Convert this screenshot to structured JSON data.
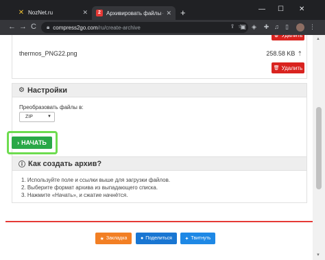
{
  "browser": {
    "tabs": [
      {
        "title": "NozNet.ru",
        "close": "✕"
      },
      {
        "title": "Архивировать файлы — Сжима",
        "close": "✕"
      }
    ],
    "new_tab": "+",
    "window_controls": {
      "minimize": "—",
      "maximize": "☐",
      "close": "✕"
    },
    "nav": {
      "back": "←",
      "forward": "→",
      "reload": "C"
    },
    "address": {
      "host": "compress2go.com",
      "path": "/ru/create-archive"
    }
  },
  "file": {
    "name": "thermos_PNG22.png",
    "size": "258.58 KB",
    "delete_label": "Удалить"
  },
  "settings": {
    "title": "Настройки",
    "convert_label": "Преобразовать файлы в:",
    "format": "ZIP"
  },
  "start_label": "НАЧАТЬ",
  "howto": {
    "title": "Как создать архив?",
    "steps": [
      "1. Используйте поле и ссылки выше для загрузки файлов.",
      "2. Выберите формат архива из выпадающего списка.",
      "3. Нажмите «Начать», и сжатие начнётся."
    ]
  },
  "share": {
    "bookmark": "Закладка",
    "facebook": "Поделиться",
    "twitter": "Твитнуть"
  },
  "colors": {
    "delete": "#d9231f",
    "start": "#29a847",
    "highlight": "#6ddc4f",
    "bookmark": "#f27f24",
    "facebook": "#1976d2",
    "twitter": "#1e88e5"
  }
}
